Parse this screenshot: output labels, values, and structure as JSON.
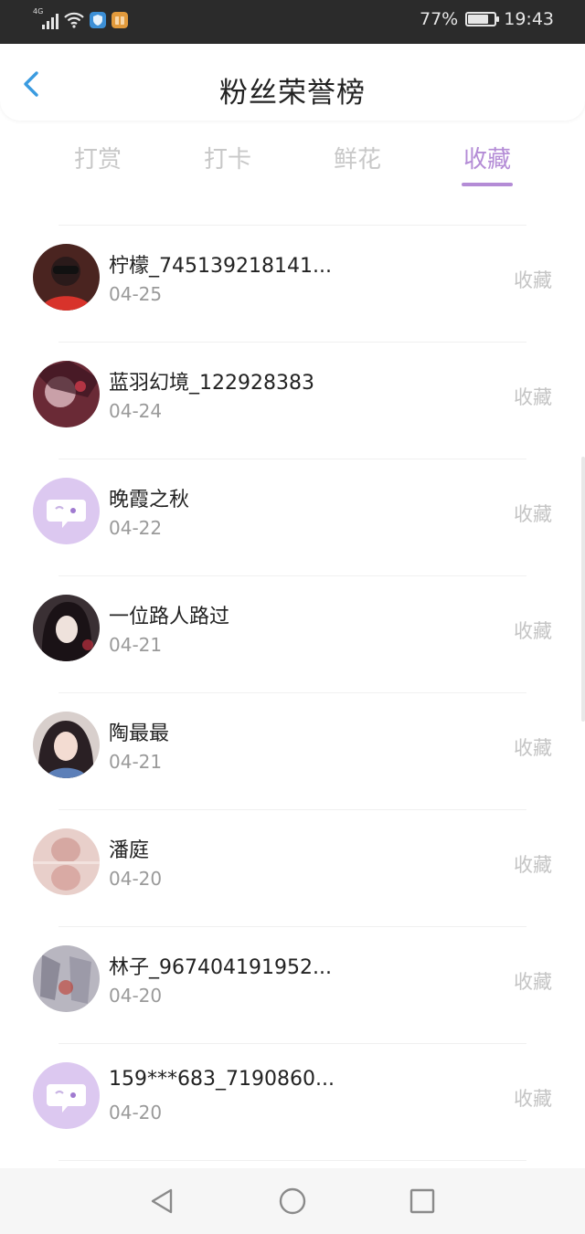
{
  "status_bar": {
    "network_label": "4G",
    "battery_percent": "77%",
    "battery_level": 0.77,
    "time": "19:43",
    "icons": [
      "signal-icon",
      "wifi-icon",
      "shield-app-icon",
      "box-app-icon",
      "battery-icon"
    ]
  },
  "header": {
    "title": "粉丝荣誉榜",
    "back_icon": "chevron-left-icon"
  },
  "tabs": [
    {
      "label": "打赏",
      "active": false
    },
    {
      "label": "打卡",
      "active": false
    },
    {
      "label": "鲜花",
      "active": false
    },
    {
      "label": "收藏",
      "active": true
    }
  ],
  "colors": {
    "accent": "#b48cd6",
    "placeholder_avatar": "#dcc8f0"
  },
  "fans": [
    {
      "name": "柠檬_745139218141...",
      "date": "04-25",
      "action": "收藏",
      "avatar": "photo"
    },
    {
      "name": "蓝羽幻境_122928383",
      "date": "04-24",
      "action": "收藏",
      "avatar": "photo"
    },
    {
      "name": "晚霞之秋",
      "date": "04-22",
      "action": "收藏",
      "avatar": "default-chat-icon"
    },
    {
      "name": "一位路人路过",
      "date": "04-21",
      "action": "收藏",
      "avatar": "photo"
    },
    {
      "name": "陶最最",
      "date": "04-21",
      "action": "收藏",
      "avatar": "photo"
    },
    {
      "name": "潘庭",
      "date": "04-20",
      "action": "收藏",
      "avatar": "photo"
    },
    {
      "name": "林子_967404191952...",
      "date": "04-20",
      "action": "收藏",
      "avatar": "photo"
    },
    {
      "name": "159***683_7190860...",
      "date": "04-20",
      "action": "收藏",
      "avatar": "default-chat-icon"
    }
  ],
  "nav_bar": [
    "back-triangle-icon",
    "home-circle-icon",
    "recents-square-icon"
  ]
}
